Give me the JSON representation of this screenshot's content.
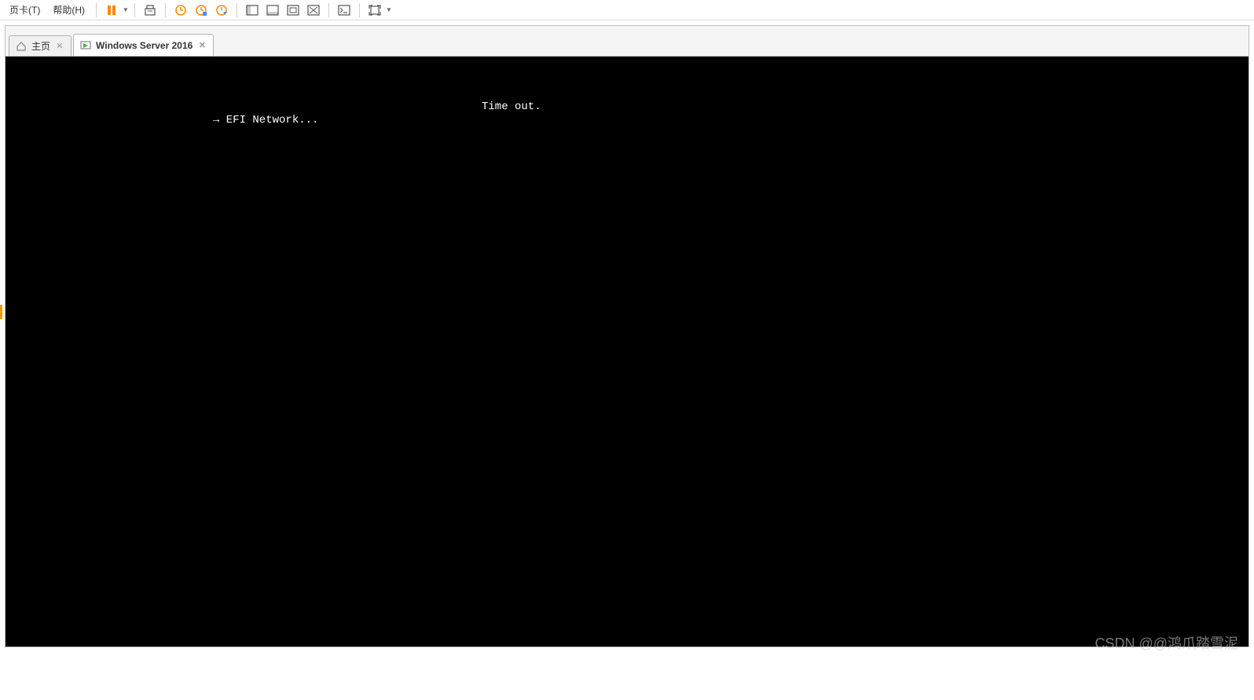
{
  "menubar": {
    "items": [
      "页卡(T)",
      "帮助(H)"
    ]
  },
  "toolbar": {
    "icons": {
      "pause": "pause-icon",
      "devices": "usb-icon",
      "snapshot_history": "snapshot-history-icon",
      "snapshot_take": "snapshot-take-icon",
      "snapshot_revert": "snapshot-revert-icon",
      "view_sidebar": "view-sidebar-icon",
      "view_bottom": "view-bottom-icon",
      "view_fullscreen": "view-fullscreen-icon",
      "view_unity": "view-unity-icon",
      "console": "console-icon",
      "expand": "expand-icon"
    }
  },
  "tabs": [
    {
      "label": "主页",
      "active": false,
      "icon": "home"
    },
    {
      "label": "Windows Server 2016",
      "active": true,
      "icon": "vm"
    }
  ],
  "console": {
    "timeout": "Time out.",
    "efi_line": "→ EFI Network..."
  },
  "watermark": "CSDN @@鸿爪踏雪泥"
}
